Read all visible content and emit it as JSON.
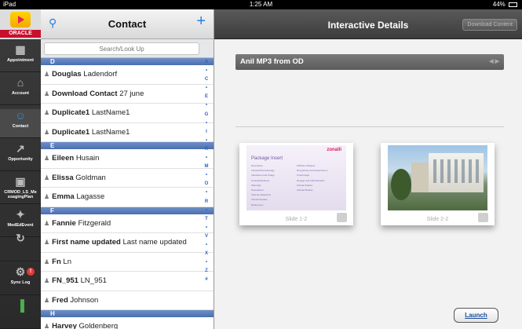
{
  "status_bar": {
    "device": "iPad",
    "time": "1:25 AM",
    "battery": "44%"
  },
  "rail": {
    "oracle": "ORACLE",
    "items": [
      {
        "label": "Appointment",
        "icon": "calendar-icon",
        "active": false
      },
      {
        "label": "Account",
        "icon": "bank-icon",
        "active": false
      },
      {
        "label": "Contact",
        "icon": "people-icon",
        "active": true
      },
      {
        "label": "Opportunity",
        "icon": "chart-icon",
        "active": false
      },
      {
        "label": "CRMOD_LS_Me ssagingPlan",
        "icon": "messaging-plan-icon",
        "active": false
      },
      {
        "label": "MedEdEvent",
        "icon": "med-event-icon",
        "active": false
      }
    ],
    "bottom": [
      {
        "label": "",
        "icon": "refresh-icon"
      },
      {
        "label": "Sync Log",
        "icon": "gear-icon",
        "badge": "!"
      },
      {
        "label": "",
        "icon": "signal-icon"
      }
    ]
  },
  "contacts": {
    "title": "Contact",
    "search_placeholder": "Search/Look Up",
    "rows": [
      {
        "type": "section",
        "label": "D"
      },
      {
        "type": "contact",
        "first": "Douglas",
        "last": "Ladendorf"
      },
      {
        "type": "contact",
        "first": "Download Contact",
        "last": "27 june"
      },
      {
        "type": "contact",
        "first": "Duplicate1",
        "last": "LastName1"
      },
      {
        "type": "contact",
        "first": "Duplicate1",
        "last": "LastName1"
      },
      {
        "type": "section",
        "label": "E"
      },
      {
        "type": "contact",
        "first": "Eileen",
        "last": "Husain"
      },
      {
        "type": "contact",
        "first": "Elissa",
        "last": "Goldman"
      },
      {
        "type": "contact",
        "first": "Emma",
        "last": "Lagasse"
      },
      {
        "type": "section",
        "label": "F"
      },
      {
        "type": "contact",
        "first": "Fannie",
        "last": "Fitzgerald"
      },
      {
        "type": "contact",
        "first": "First name updated",
        "last": "Last name updated"
      },
      {
        "type": "contact",
        "first": "Fn",
        "last": "Ln"
      },
      {
        "type": "contact",
        "first": "FN_951",
        "last": "LN_951"
      },
      {
        "type": "contact",
        "first": "Fred",
        "last": "Johnson"
      },
      {
        "type": "section",
        "label": "H"
      },
      {
        "type": "contact",
        "first": "Harvey",
        "last": "Goldenberg"
      }
    ],
    "index_letters": [
      "A",
      "•",
      "C",
      "•",
      "E",
      "•",
      "G",
      "•",
      "I",
      "•",
      "K",
      "•",
      "M",
      "•",
      "O",
      "•",
      "R",
      "•",
      "T",
      "•",
      "V",
      "•",
      "X",
      "•",
      "Z",
      "#"
    ]
  },
  "detail": {
    "title": "Interactive Details",
    "download_label": "Download Content",
    "media_title": "Anil MP3 from OD",
    "slides": [
      {
        "label": "Slide 1-2",
        "thumb_title": "Package Insert",
        "brand": "zonalli",
        "left_items": [
          "Description",
          "Clinical Pharmacology",
          "Indications and Usage",
          "Contraindications",
          "Warnings",
          "Precautions",
          "Adverse Reactions",
          "Clinical Studies",
          "References"
        ],
        "right_items": [
          "ZONALL Plaquex",
          "Drug Abuse and Dependence",
          "Overdosage",
          "Dosage and Administration",
          "Animal Studies",
          "Clinical Studies"
        ]
      },
      {
        "label": "Slide 2-2"
      }
    ],
    "launch_label": "Launch"
  }
}
